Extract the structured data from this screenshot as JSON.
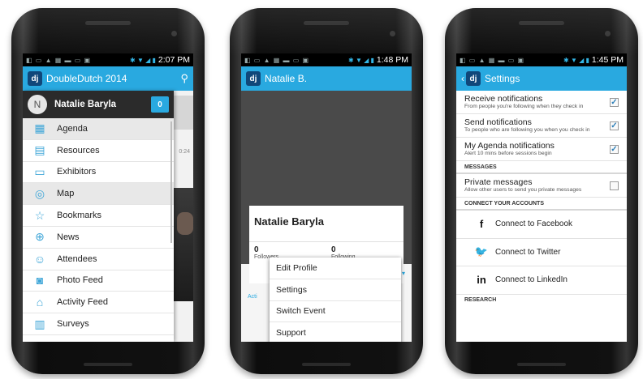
{
  "screens": {
    "menu": {
      "status_time": "2:07 PM",
      "app_title": "DoubleDutch 2014",
      "logo_text": "dj",
      "avatar_initial": "N",
      "user_name": "Natalie Baryla",
      "badge_count": "0",
      "menu_items": [
        {
          "label": "Agenda",
          "icon": "calendar-icon"
        },
        {
          "label": "Resources",
          "icon": "book-icon"
        },
        {
          "label": "Exhibitors",
          "icon": "booth-icon"
        },
        {
          "label": "Map",
          "icon": "map-pin-icon"
        },
        {
          "label": "Bookmarks",
          "icon": "star-icon"
        },
        {
          "label": "News",
          "icon": "globe-icon"
        },
        {
          "label": "Attendees",
          "icon": "people-icon"
        },
        {
          "label": "Photo Feed",
          "icon": "camera-icon"
        },
        {
          "label": "Activity Feed",
          "icon": "home-icon"
        },
        {
          "label": "Surveys",
          "icon": "bar-chart-icon"
        }
      ],
      "behind_time": "0:24"
    },
    "profile": {
      "status_time": "1:48 PM",
      "title": "Natalie B.",
      "logo_text": "dj",
      "name": "Natalie Baryla",
      "followers_count": "0",
      "followers_label": "Followers",
      "following_count": "0",
      "following_label": "Following",
      "tab_peek": "Acti",
      "popup_items": [
        "Edit Profile",
        "Settings",
        "Switch Event",
        "Support"
      ]
    },
    "settings": {
      "status_time": "1:45 PM",
      "title": "Settings",
      "logo_text": "dj",
      "rows": [
        {
          "title": "Receive notifications",
          "desc": "From people you're following when they check in",
          "checked": true
        },
        {
          "title": "Send notifications",
          "desc": "To people who are following you when you check in",
          "checked": true
        },
        {
          "title": "My Agenda notifications",
          "desc": "Alert 10 mins before sessions begin",
          "checked": true
        }
      ],
      "messages_header": "MESSAGES",
      "private_messages": {
        "title": "Private messages",
        "desc": "Allow other users to send you private messages",
        "checked": false
      },
      "connect_header": "CONNECT YOUR ACCOUNTS",
      "social": [
        {
          "label": "Connect to Facebook",
          "icon_glyph": "f",
          "icon": "facebook-icon"
        },
        {
          "label": "Connect to Twitter",
          "icon_glyph": "🐦",
          "icon": "twitter-icon"
        },
        {
          "label": "Connect to LinkedIn",
          "icon_glyph": "in",
          "icon": "linkedin-icon"
        }
      ],
      "research_header": "RESEARCH"
    }
  },
  "colors": {
    "accent": "#29a9e0",
    "logo_bg": "#10477a",
    "drawer_header": "#2b2b2b"
  }
}
